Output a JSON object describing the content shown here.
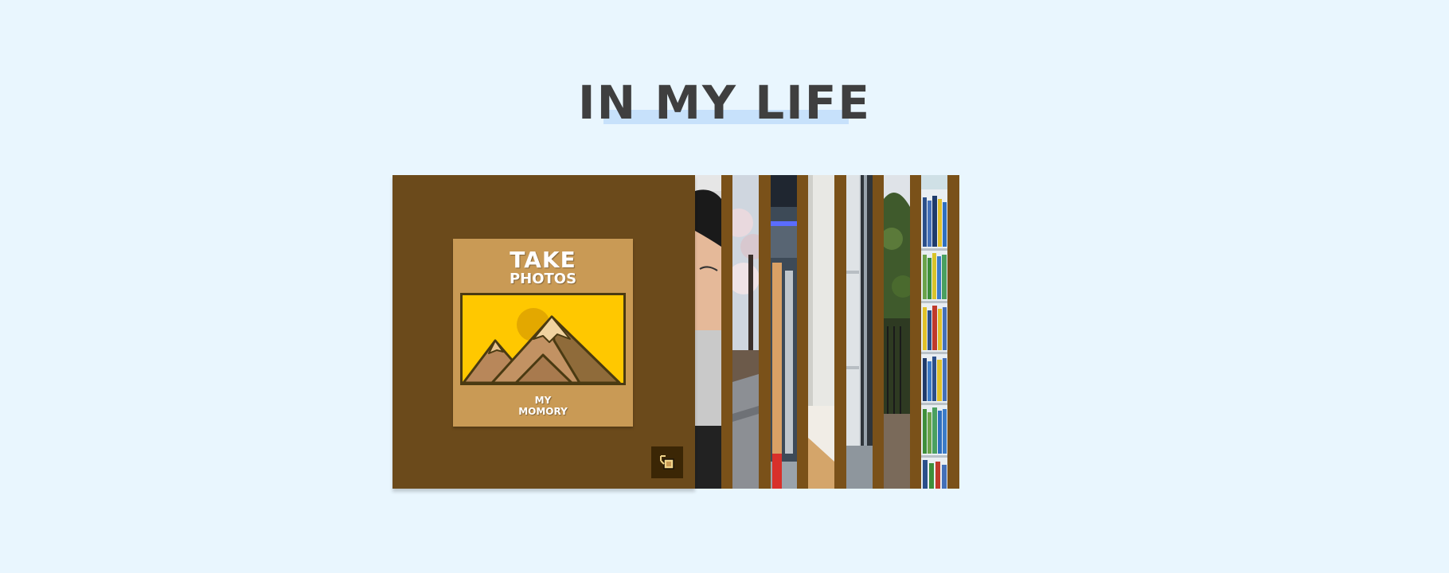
{
  "header": {
    "title": "IN MY LIFE"
  },
  "colors": {
    "background": "#e9f6fe",
    "title_text": "#3f3f3f",
    "title_highlight": "#c7e1fb",
    "cover": "#6b4a1b",
    "poster": "#c99a55",
    "frame_sky": "#ffc800",
    "strip_gap": "#7a5119"
  },
  "cover": {
    "poster": {
      "title": "TAKE",
      "subtitle": "PHOTOS",
      "caption_line1": "MY",
      "caption_line2": "MOMORY",
      "icon": "mountain-sun-icon"
    },
    "corner_button_icon": "toggle-gallery-icon"
  },
  "strips": [
    {
      "name": "portrait-photo-strip",
      "icon": "person-photo"
    },
    {
      "name": "cherry-blossom-path-strip",
      "icon": "tree-photo"
    },
    {
      "name": "indoor-hallway-strip",
      "icon": "interior-photo"
    },
    {
      "name": "wall-corner-strip",
      "icon": "wall-photo"
    },
    {
      "name": "window-frame-strip",
      "icon": "window-photo"
    },
    {
      "name": "garden-trees-strip",
      "icon": "garden-photo"
    },
    {
      "name": "bookshelf-strip",
      "icon": "bookshelf-photo"
    }
  ]
}
